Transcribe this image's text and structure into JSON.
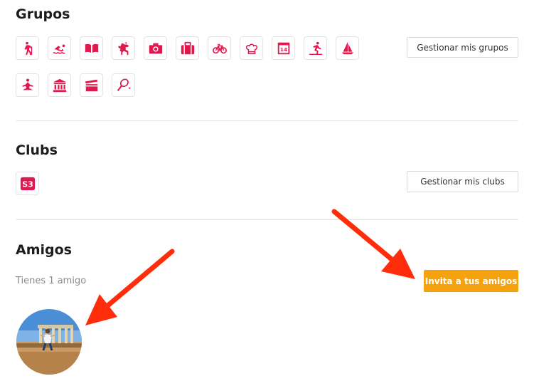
{
  "colors": {
    "accent": "#e0184e",
    "primary_button": "#f4a20e",
    "arrow": "#ff2d0c"
  },
  "groups": {
    "title": "Grupos",
    "manage_label": "Gestionar mis grupos",
    "icons": [
      "hiking-icon",
      "swimming-icon",
      "book-icon",
      "dog-icon",
      "camera-icon",
      "suitcase-icon",
      "bicycle-icon",
      "chef-hat-icon",
      "calendar-icon",
      "ski-icon",
      "sailboat-icon",
      "yoga-icon",
      "museum-icon",
      "clapperboard-icon",
      "tennis-icon"
    ],
    "calendar_day": "14"
  },
  "clubs": {
    "title": "Clubs",
    "manage_label": "Gestionar mis clubs",
    "club_logo_text": "S3"
  },
  "friends": {
    "title": "Amigos",
    "count_text": "Tienes 1 amigo",
    "invite_label": "Invita a tus amigos"
  }
}
